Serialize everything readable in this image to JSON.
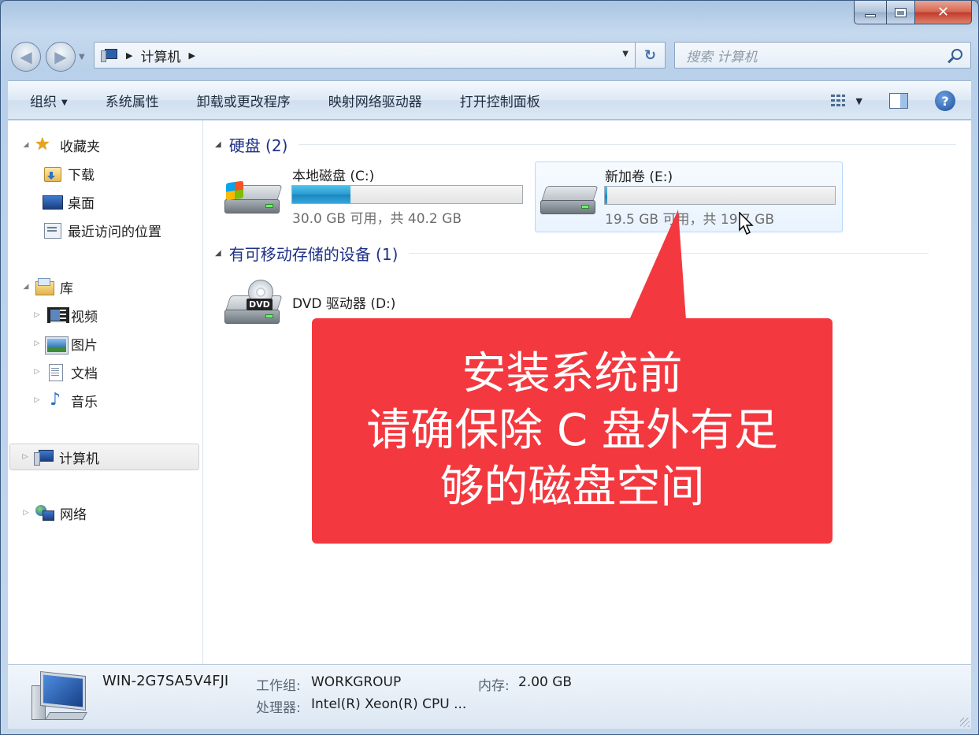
{
  "window": {
    "caption_buttons": {
      "close_glyph": "✕"
    }
  },
  "navigation": {
    "back_glyph": "◀",
    "forward_glyph": "▶",
    "address": {
      "crumbs": [
        "计算机"
      ]
    },
    "search_placeholder": "搜索 计算机"
  },
  "command_bar": {
    "organize": "组织",
    "items": [
      "系统属性",
      "卸载或更改程序",
      "映射网络驱动器",
      "打开控制面板"
    ],
    "help_glyph": "?"
  },
  "nav_pane": {
    "favorites": {
      "label": "收藏夹",
      "children": [
        "下载",
        "桌面",
        "最近访问的位置"
      ]
    },
    "libraries": {
      "label": "库",
      "children": [
        "视频",
        "图片",
        "文档",
        "音乐"
      ]
    },
    "computer": "计算机",
    "network": "网络"
  },
  "content": {
    "hard_disks": {
      "header": "硬盘 (2)",
      "drives": [
        {
          "name": "本地磁盘 (C:)",
          "info": "30.0 GB 可用，共 40.2 GB",
          "used_fraction": 0.254
        },
        {
          "name": "新加卷 (E:)",
          "info": "19.5 GB 可用，共 19.7 GB",
          "used_fraction": 0.01
        }
      ]
    },
    "removable": {
      "header": "有可移动存储的设备 (1)",
      "devices": [
        {
          "name": "DVD 驱动器 (D:)",
          "badge": "DVD"
        }
      ]
    }
  },
  "callout": {
    "lines": [
      "安装系统前",
      "请确保除 C 盘外有足",
      "够的磁盘空间"
    ],
    "color": "#f4383f"
  },
  "details": {
    "computer_name": "WIN-2G7SA5V4FJI",
    "workgroup_label": "工作组:",
    "workgroup_value": "WORKGROUP",
    "memory_label": "内存:",
    "memory_value": "2.00 GB",
    "processor_label": "处理器:",
    "processor_value": "Intel(R) Xeon(R) CPU ..."
  }
}
